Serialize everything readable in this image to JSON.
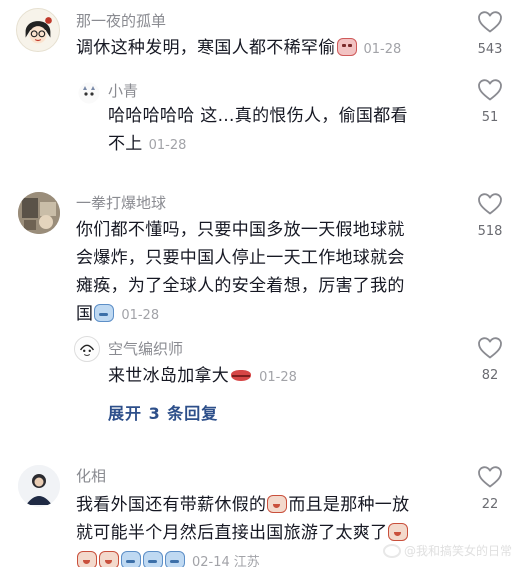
{
  "comments": [
    {
      "username": "那一夜的孤单",
      "text_a": "调休这种发明，寒国人都不稀罕偷",
      "emoji_a": "cry-emoji",
      "date": "01-28",
      "likes": "543"
    },
    {
      "username": "小青",
      "text_a": "哈哈哈哈哈 这…真的恨伤人，偷国都看",
      "text_b": "不上",
      "date": "01-28",
      "likes": "51"
    },
    {
      "username": "一拳打爆地球",
      "text_a": "你们都不懂吗，只要中国多放一天假地球就",
      "text_b": "会爆炸，只要中国人停止一天工作地球就会",
      "text_c": "瘫痪，为了全球人的安全着想，厉害了我的",
      "text_d": "国",
      "emoji_d": "blue-blush-emoji",
      "date": "01-28",
      "likes": "518"
    },
    {
      "username": "空气编织师",
      "text_a": "来世冰岛加拿大",
      "emoji_a": "lips-emoji",
      "date": "01-28",
      "likes": "82"
    },
    {
      "username": "化相",
      "text_a": "我看外国还有带薪休假的",
      "text_a2": "而且是那种一放",
      "text_b": "就可能半个月然后直接出国旅游了太爽了",
      "date": "02-14",
      "location": "江苏",
      "likes": "22"
    }
  ],
  "expand_replies": "展开 3 条回复",
  "watermark": "@我和搞笑女的日常",
  "colors": {
    "accent_link": "#2d4f8a",
    "text": "#161823",
    "muted": "#8a8b91"
  }
}
